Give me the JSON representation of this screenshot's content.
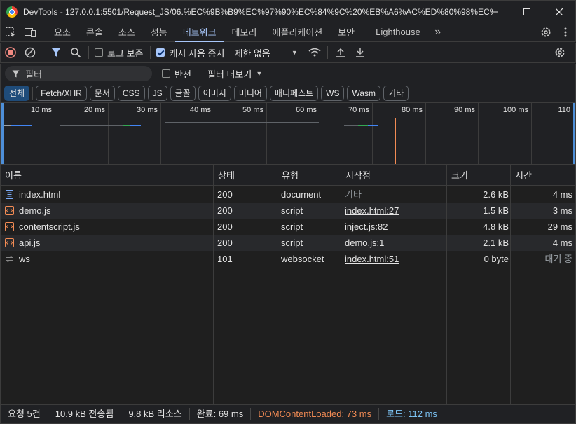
{
  "window": {
    "title": "DevTools - 127.0.0.1:5501/Request_JS/06.%EC%9B%B9%EC%97%90%EC%84%9C%20%EB%A6%AC%ED%80%98%EC%8...",
    "minimize_icon": "minimize-icon",
    "maximize_icon": "maximize-icon",
    "close_icon": "close-icon"
  },
  "panel_tabs": {
    "items": [
      "요소",
      "콘솔",
      "소스",
      "성능",
      "네트워크",
      "메모리",
      "애플리케이션",
      "보안",
      "Lighthouse"
    ],
    "active": "네트워크",
    "more_label": "»"
  },
  "toolbar": {
    "preserve_log_label": "로그 보존",
    "preserve_log_checked": false,
    "disable_cache_label": "캐시 사용 중지",
    "disable_cache_checked": true,
    "throttle_label": "제한 없음"
  },
  "filter": {
    "placeholder": "필터",
    "invert_label": "반전",
    "more_filters_label": "필터 더보기"
  },
  "type_chips": [
    "전체",
    "Fetch/XHR",
    "문서",
    "CSS",
    "JS",
    "글꼴",
    "이미지",
    "미디어",
    "매니페스트",
    "WS",
    "Wasm",
    "기타"
  ],
  "type_chip_active": "전체",
  "overview": {
    "ticks": [
      "10 ms",
      "20 ms",
      "30 ms",
      "40 ms",
      "50 ms",
      "60 ms",
      "70 ms",
      "80 ms",
      "90 ms",
      "100 ms",
      "110"
    ]
  },
  "table": {
    "headers": [
      "이름",
      "상태",
      "유형",
      "시작점",
      "크기",
      "시간"
    ],
    "rows": [
      {
        "name": "index.html",
        "icon": "document-icon",
        "status": "200",
        "type": "document",
        "initiator": "기타",
        "initiator_link": false,
        "size": "2.6 kB",
        "time": "4 ms"
      },
      {
        "name": "demo.js",
        "icon": "script-icon",
        "status": "200",
        "type": "script",
        "initiator": "index.html:27",
        "initiator_link": true,
        "size": "1.5 kB",
        "time": "3 ms"
      },
      {
        "name": "contentscript.js",
        "icon": "script-icon",
        "status": "200",
        "type": "script",
        "initiator": "inject.js:82",
        "initiator_link": true,
        "size": "4.8 kB",
        "time": "29 ms"
      },
      {
        "name": "api.js",
        "icon": "script-icon",
        "status": "200",
        "type": "script",
        "initiator": "demo.js:1",
        "initiator_link": true,
        "size": "2.1 kB",
        "time": "4 ms"
      },
      {
        "name": "ws",
        "icon": "websocket-icon",
        "status": "101",
        "type": "websocket",
        "initiator": "index.html:51",
        "initiator_link": true,
        "size": "0 byte",
        "time": "대기 중"
      }
    ]
  },
  "status": {
    "requests": "요청 5건",
    "transferred": "10.9 kB 전송됨",
    "resources": "9.8 kB 리소스",
    "finish": "완료: 69 ms",
    "dom_content_loaded": "DOMContentLoaded: 73 ms",
    "load": "로드: 112 ms"
  },
  "colors": {
    "accent": "#a8c7fa",
    "dcl": "#f28b54",
    "load": "#7cc4f5",
    "record": "#f28b82"
  }
}
